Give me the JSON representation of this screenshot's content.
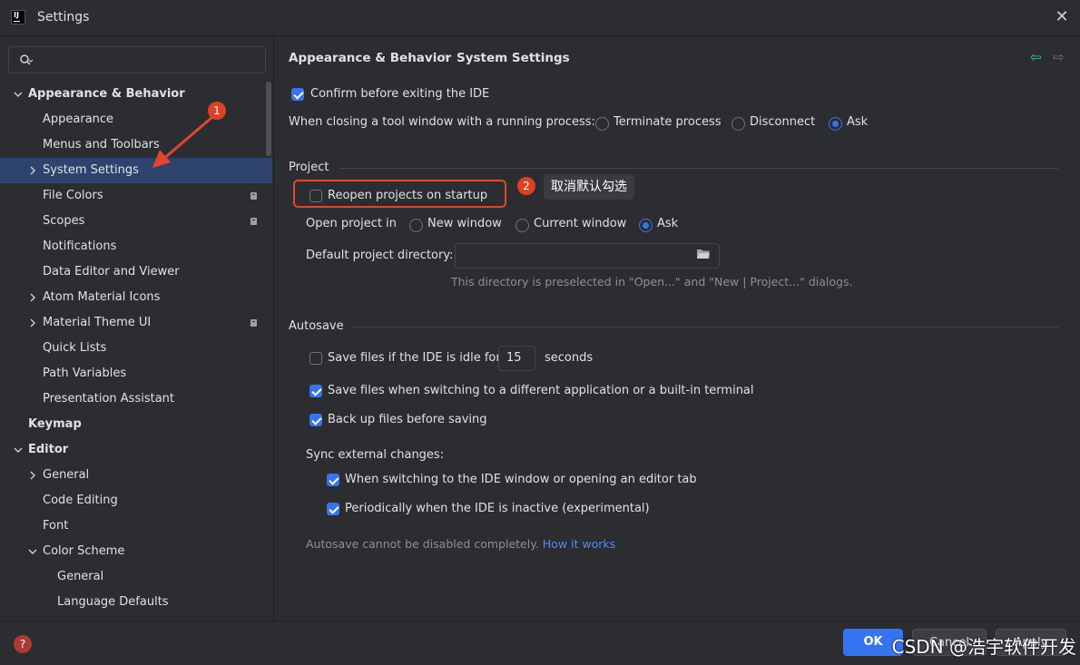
{
  "window": {
    "title": "Settings"
  },
  "search": {
    "placeholder": ""
  },
  "sidebar": {
    "items": [
      {
        "label": "Appearance & Behavior",
        "level": 0,
        "expanded": true,
        "bold": true
      },
      {
        "label": "Appearance",
        "level": 1
      },
      {
        "label": "Menus and Toolbars",
        "level": 1
      },
      {
        "label": "System Settings",
        "level": 1,
        "collapsed": true,
        "selected": true
      },
      {
        "label": "File Colors",
        "level": 1,
        "badge": true
      },
      {
        "label": "Scopes",
        "level": 1,
        "badge": true
      },
      {
        "label": "Notifications",
        "level": 1
      },
      {
        "label": "Data Editor and Viewer",
        "level": 1
      },
      {
        "label": "Atom Material Icons",
        "level": 1,
        "collapsed": true
      },
      {
        "label": "Material Theme UI",
        "level": 1,
        "collapsed": true,
        "badge": true
      },
      {
        "label": "Quick Lists",
        "level": 1
      },
      {
        "label": "Path Variables",
        "level": 1
      },
      {
        "label": "Presentation Assistant",
        "level": 1
      },
      {
        "label": "Keymap",
        "level": 0,
        "bold": true
      },
      {
        "label": "Editor",
        "level": 0,
        "expanded": true,
        "bold": true
      },
      {
        "label": "General",
        "level": 1,
        "collapsed": true
      },
      {
        "label": "Code Editing",
        "level": 1
      },
      {
        "label": "Font",
        "level": 1
      },
      {
        "label": "Color Scheme",
        "level": 1,
        "expanded": true
      },
      {
        "label": "General",
        "level": 2
      },
      {
        "label": "Language Defaults",
        "level": 2
      }
    ]
  },
  "breadcrumb": {
    "parent": "Appearance & Behavior",
    "current": "System Settings"
  },
  "general": {
    "confirm_exit": {
      "label": "Confirm before exiting the IDE",
      "checked": true
    },
    "closing_label": "When closing a tool window with a running process:",
    "closing_options": [
      {
        "label": "Terminate process",
        "selected": false
      },
      {
        "label": "Disconnect",
        "selected": false
      },
      {
        "label": "Ask",
        "selected": true
      }
    ]
  },
  "project": {
    "title": "Project",
    "reopen": {
      "label": "Reopen projects on startup",
      "checked": false
    },
    "open_in_label": "Open project in",
    "open_in_options": [
      {
        "label": "New window",
        "selected": false
      },
      {
        "label": "Current window",
        "selected": false
      },
      {
        "label": "Ask",
        "selected": true
      }
    ],
    "default_dir_label": "Default project directory:",
    "default_dir_value": "",
    "hint": "This directory is preselected in \"Open...\" and \"New | Project...\" dialogs."
  },
  "autosave": {
    "title": "Autosave",
    "idle": {
      "label": "Save files if the IDE is idle for",
      "checked": false,
      "value": "15",
      "unit": "seconds"
    },
    "switching": {
      "label": "Save files when switching to a different application or a built-in terminal",
      "checked": true
    },
    "backup": {
      "label": "Back up files before saving",
      "checked": true
    },
    "sync_label": "Sync external changes:",
    "sync_switch": {
      "label": "When switching to the IDE window or opening an editor tab",
      "checked": true
    },
    "sync_periodic": {
      "label": "Periodically when the IDE is inactive (experimental)",
      "checked": true
    },
    "note": "Autosave cannot be disabled completely.",
    "note_link": "How it works"
  },
  "annotations": {
    "marker1": "1",
    "marker2": "2",
    "tooltip": "取消默认勾选"
  },
  "footer": {
    "help": "?",
    "ok_label": "OK",
    "cancel_label": "Cancel",
    "apply_label": "Apply",
    "watermark": "CSDN @浩宇软件开发"
  },
  "colors": {
    "accent": "#3574f0",
    "selection": "#2e436e",
    "annotation": "#e2462c",
    "background": "#2b2d30"
  }
}
